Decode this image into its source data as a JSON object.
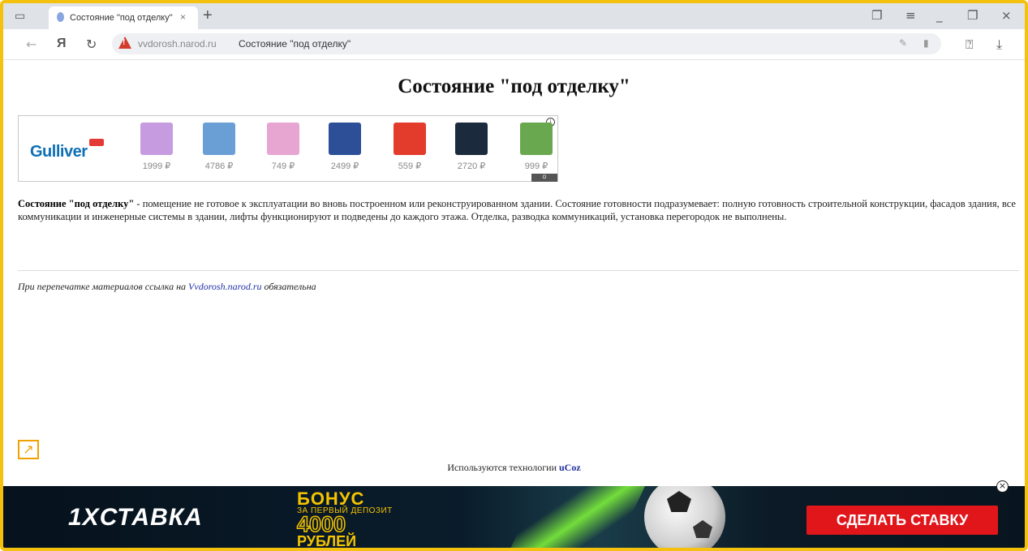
{
  "browser": {
    "tab_title": "Состояние \"под отделку\"",
    "tab_close": "×",
    "new_tab": "+",
    "url_domain": "vvdorosh.narod.ru",
    "url_title": "Состояние \"под отделку\"",
    "back_icon": "←",
    "yandex_logo": "Я",
    "reload_icon": "↻",
    "download_icon": "⤓"
  },
  "page": {
    "heading": "Состояние \"под отделку\"",
    "desc_bold": "Состояние \"под отделку\"",
    "desc_text": " - помещение не готовое к эксплуатации во вновь построенном или реконструированном здании. Состояние готовности подразумевает: полную готовность строительной конструкции, фасадов здания, все коммуникации и инженерные системы в здании, лифты функционируют и подведены до каждого этажа. Отделка, разводка коммуникаций, установка перегородок не выполнены.",
    "reprint_prefix": "При перепечатке материалов ссылка на ",
    "reprint_link": "Vvdorosh.narod.ru",
    "reprint_suffix": " обязательна",
    "ucoz_prefix": "Используются технологии ",
    "ucoz_brand": "uCoz"
  },
  "ad": {
    "brand": "Gulliver",
    "info_icon": "i",
    "label": "О компании",
    "products": [
      {
        "price": "1999 ₽",
        "color": "#c79be0"
      },
      {
        "price": "4786 ₽",
        "color": "#6a9fd6"
      },
      {
        "price": "749 ₽",
        "color": "#e7a6d2"
      },
      {
        "price": "2499 ₽",
        "color": "#2c4f98"
      },
      {
        "price": "559 ₽",
        "color": "#e33b2c"
      },
      {
        "price": "2720 ₽",
        "color": "#1b2a3c"
      },
      {
        "price": "999 ₽",
        "color": "#6aa84f"
      }
    ]
  },
  "banner": {
    "logo": "1XСТАВКА",
    "bonus_line1": "БОНУС",
    "bonus_line2": "ЗА ПЕРВЫЙ ДЕПОЗИТ",
    "bonus_amount": "4000",
    "bonus_currency": "РУБЛЕЙ",
    "cta": "СДЕЛАТЬ СТАВКУ",
    "close_icon": "×"
  }
}
